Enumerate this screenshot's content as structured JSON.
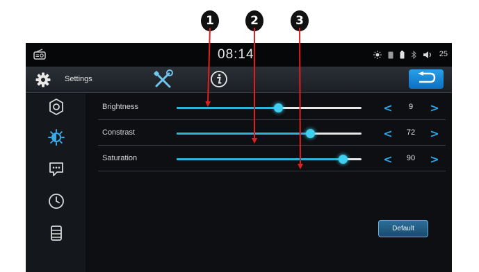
{
  "callouts": [
    "1",
    "2",
    "3"
  ],
  "status_bar": {
    "time": "08:14",
    "volume_level": "25",
    "icons": [
      "radio-icon",
      "sun-icon",
      "sim-icon",
      "battery-icon",
      "bluetooth-icon",
      "speaker-icon"
    ]
  },
  "header": {
    "title": "Settings",
    "icons": [
      "gear-icon",
      "tools-icon",
      "info-icon",
      "back-arrow-icon"
    ]
  },
  "sidebar": {
    "items": [
      {
        "icon": "general-settings-icon",
        "selected": false
      },
      {
        "icon": "display-settings-icon",
        "selected": true
      },
      {
        "icon": "message-icon",
        "selected": false
      },
      {
        "icon": "clock-icon",
        "selected": false
      },
      {
        "icon": "storage-icon",
        "selected": false
      }
    ]
  },
  "settings": [
    {
      "label": "Brightness",
      "value": "9",
      "level_percent": 55
    },
    {
      "label": "Constrast",
      "value": "72",
      "level_percent": 72
    },
    {
      "label": "Saturation",
      "value": "90",
      "level_percent": 90
    }
  ],
  "default_button": "Default",
  "colors": {
    "accent": "#2aa8ea",
    "slider_fill": "#2fb3d8",
    "annotation_arrow": "#e02020",
    "back_button": "#0b6fc1"
  }
}
